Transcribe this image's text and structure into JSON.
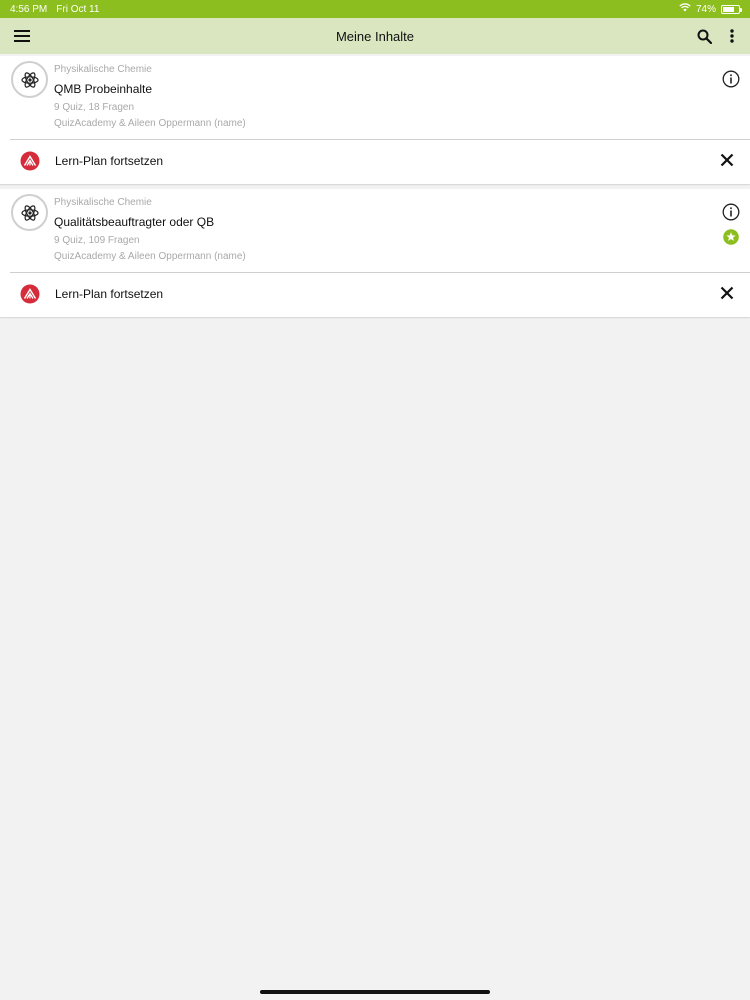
{
  "status_bar": {
    "time": "4:56 PM",
    "date": "Fri Oct 11",
    "battery_percent": "74%",
    "battery_level": 0.74
  },
  "toolbar": {
    "title": "Meine Inhalte",
    "icons": [
      "menu-icon",
      "search-icon",
      "more-vertical-icon"
    ]
  },
  "courses": [
    {
      "category": "Physikalische Chemie",
      "title": "QMB Probeinhalte",
      "stats": "9 Quiz, 18 Fragen",
      "authors": "QuizAcademy & Aileen Oppermann (name)",
      "has_star": false,
      "action_label": "Lern-Plan fortsetzen"
    },
    {
      "category": "Physikalische Chemie",
      "title": "Qualitätsbeauftragter oder QB",
      "stats": "9 Quiz, 109 Fragen",
      "authors": "QuizAcademy & Aileen Oppermann (name)",
      "has_star": true,
      "action_label": "Lern-Plan fortsetzen"
    }
  ],
  "colors": {
    "status_bar": "#8dbe1f",
    "toolbar": "#d9e6c0",
    "plan_icon": "#d62b3a",
    "star_badge": "#8dbe1f"
  }
}
